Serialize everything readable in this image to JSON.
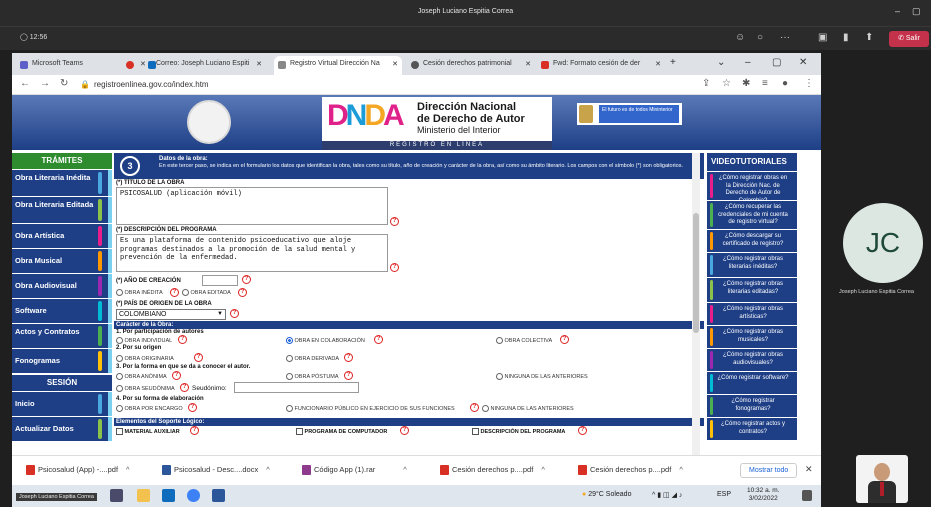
{
  "teams": {
    "title": "Joseph Luciano Espitia Correa",
    "timer": "12:56",
    "leave_label": "Salir",
    "participant_initials": "JC",
    "participant_name": "Joseph Luciano Espitia Correa",
    "self_label": "Joseph Luciano Espitia Correa"
  },
  "browser": {
    "tabs": [
      {
        "label": "Microsoft Teams",
        "color": "#5b5fc7"
      },
      {
        "label": "Correo: Joseph Luciano Espiti",
        "color": "#0f6cbd"
      },
      {
        "label": "Registro Virtual Dirección Na",
        "color": "#888888"
      },
      {
        "label": "Cesión derechos patrimonial",
        "color": "#555555"
      },
      {
        "label": "Fwd: Formato cesión de der",
        "color": "#d93025"
      }
    ],
    "url": "registroenlinea.gov.co/index.htm"
  },
  "site": {
    "logo_text": "DNDA",
    "org_line1": "Dirección Nacional",
    "org_line2": "de Derecho de Autor",
    "org_line3": "Ministerio del Interior",
    "strip": "REGISTRO EN LÍNEA",
    "gov_text": "El futuro es de todos   Mininterior"
  },
  "left_nav": {
    "header": "TRÁMITES",
    "items": [
      {
        "label": "Obra Literaria Inédita",
        "stripe": "#4aa8e0"
      },
      {
        "label": "Obra Literaria Editada",
        "stripe": "#8bc34a"
      },
      {
        "label": "Obra Artística",
        "stripe": "#e91e8c"
      },
      {
        "label": "Obra Musical",
        "stripe": "#ff9800"
      },
      {
        "label": "Obra Audiovisual",
        "stripe": "#9c27b0"
      },
      {
        "label": "Software",
        "stripe": "#00bcd4"
      },
      {
        "label": "Actos y Contratos",
        "stripe": "#4caf50"
      },
      {
        "label": "Fonogramas",
        "stripe": "#ffc107"
      }
    ],
    "session_header": "SESIÓN",
    "session_items": [
      {
        "label": "Inicio",
        "stripe": "#4aa8e0"
      },
      {
        "label": "Actualizar Datos",
        "stripe": "#8bc34a"
      }
    ]
  },
  "right_nav": {
    "header": "VIDEOTUTORIALES",
    "items": [
      {
        "label": "¿Cómo registrar obras en la Dirección Nac. de Derecho de Autor de Colombia?",
        "stripe": "#e91e8c"
      },
      {
        "label": "¿Cómo recuperar las credenciales de mi cuenta de registro virtual?",
        "stripe": "#4caf50"
      },
      {
        "label": "¿Cómo descargar su certificado de registro?",
        "stripe": "#ff9800"
      },
      {
        "label": "¿Cómo registrar obras literarias inéditas?",
        "stripe": "#4aa8e0"
      },
      {
        "label": "¿Cómo registrar obras literarias editadas?",
        "stripe": "#8bc34a"
      },
      {
        "label": "¿Cómo registrar obras artísticas?",
        "stripe": "#e91e8c"
      },
      {
        "label": "¿Cómo registrar obras musicales?",
        "stripe": "#ff9800"
      },
      {
        "label": "¿Cómo registrar obras audiovisuales?",
        "stripe": "#9c27b0"
      },
      {
        "label": "¿Cómo registrar software?",
        "stripe": "#00bcd4"
      },
      {
        "label": "¿Cómo registrar fonogramas?",
        "stripe": "#4caf50"
      },
      {
        "label": "¿Cómo registrar actos y contratos?",
        "stripe": "#ffc107"
      }
    ]
  },
  "form": {
    "step_number": "3",
    "step_title": "Datos de la obra:",
    "step_desc": "En este tercer paso, se indica en el formulario los datos que identifican la obra, tales como su título, año de creación y carácter de la obra, así como su ámbito literario. Los campos con el símbolo (*) son obligatorios.",
    "title_label": "(*) TÍTULO DE LA OBRA",
    "title_value": "PSICOSALUD (aplicación móvil)",
    "desc_label": "(*) DESCRIPCIÓN DEL PROGRAMA",
    "desc_value": "Es una plataforma de contenido psicoeducativo que aloje\nprogramas destinados a la promoción de la salud mental y\nprevención de la enfermedad.",
    "year_label": "(*) AÑO DE CREACIÓN",
    "year_value": "",
    "opt_inedita": "OBRA INÉDITA",
    "opt_editada": "OBRA EDITADA",
    "country_label": "(*) PAÍS DE ORIGEN DE LA OBRA",
    "country_value": "COLOMBIANO",
    "caracter_header": "Carácter de la Obra:",
    "q1": "1. Por participación de autores",
    "q1_opts": [
      "OBRA INDIVIDUAL",
      "OBRA EN COLABORACIÓN",
      "OBRA COLECTIVA"
    ],
    "q2": "2. Por su origen",
    "q2_opts": [
      "OBRA ORIGINARIA",
      "OBRA DERIVADA"
    ],
    "q3": "3. Por la forma en que se da a conocer el autor.",
    "q3_opts": [
      "OBRA ANÓNIMA",
      "OBRA PÓSTUMA",
      "NINGUNA DE LAS ANTERIORES"
    ],
    "q3_pseud": "OBRA SEUDÓNIMA",
    "pseud_label": "Seudónimo:",
    "q4": "4. Por su forma de elaboración",
    "q4_opts": [
      "OBRA POR ENCARGO",
      "FUNCIONARIO PÚBLICO EN EJERCICIO DE SUS FUNCIONES",
      "NINGUNA DE LAS ANTERIORES"
    ],
    "elements_header": "Elementos del Soporte Lógico:",
    "elements": [
      "MATERIAL AUXILIAR",
      "PROGRAMA DE COMPUTADOR",
      "DESCRIPCIÓN DEL PROGRAMA"
    ]
  },
  "downloads": {
    "items": [
      {
        "label": "Psicosalud (App) -....pdf",
        "color": "#d93025"
      },
      {
        "label": "Psicosalud - Desc....docx",
        "color": "#2b579a"
      },
      {
        "label": "Código App (1).rar",
        "color": "#8e3b8e"
      },
      {
        "label": "Cesión derechos p....pdf",
        "color": "#d93025"
      },
      {
        "label": "Cesión derechos p....pdf",
        "color": "#d93025"
      }
    ],
    "show_all": "Mostrar todo"
  },
  "taskbar": {
    "name_chip": "Joseph Luciano Espitia Correa",
    "weather": "29°C Soleado",
    "lang": "ESP",
    "time": "10:32 a. m.",
    "date": "3/02/2022"
  }
}
